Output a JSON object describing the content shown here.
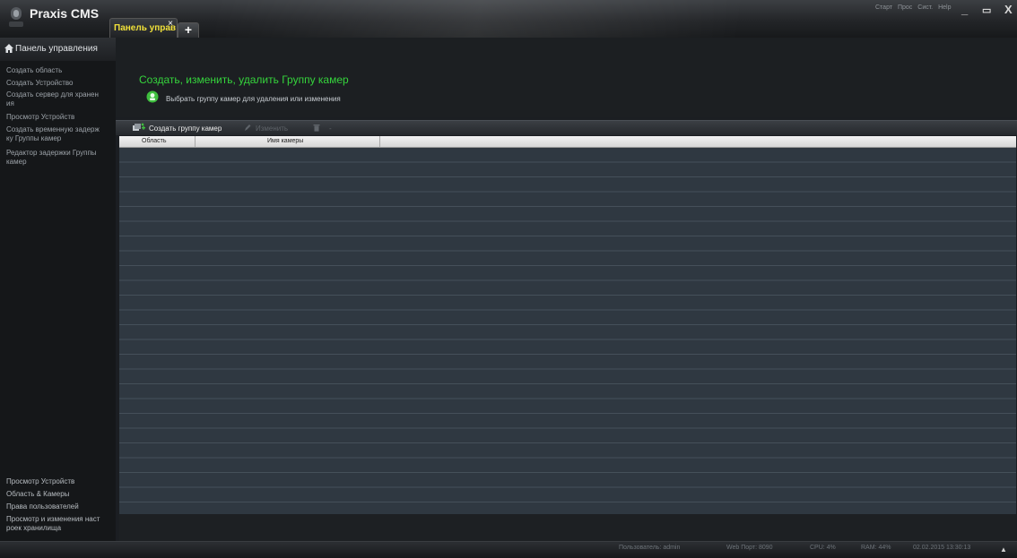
{
  "app": {
    "title": "Praxis CMS"
  },
  "tabs": [
    {
      "label": "Панель управ",
      "close": "×"
    },
    {
      "label": "+"
    }
  ],
  "top_menu": [
    "Старт",
    "Проc",
    "Сист.",
    "Help"
  ],
  "window_controls": [
    "_",
    "▭",
    "X"
  ],
  "sidebar": {
    "header": "Панель управления",
    "items": [
      "Создать область",
      "Создать Устройство",
      "Создать сервер для хранен\nия",
      "Просмотр Устройств",
      "Создать временную задерж\nку Группы камер",
      "Редактор задержки Группы\nкамер"
    ],
    "bottom_items": [
      "Просмотр Устройств",
      "Область & Камеры",
      "Права пользователей",
      "Просмотр и изменения наст\nроек хранилища"
    ]
  },
  "main": {
    "title": "Создать, изменить, удалить Группу камер",
    "info_text": "Выбрать группу камер для удаления или изменения",
    "toolbar": {
      "create_label": "Создать группу камер",
      "edit_label": "Изменить",
      "delete_label": "-"
    },
    "table": {
      "columns": [
        "Область",
        "Имя камеры"
      ],
      "rows": []
    }
  },
  "status": {
    "user": "Пользователь: admin",
    "port": "Web Порт: 8090",
    "cpu": "CPU: 4%",
    "ram": "RAM: 44%",
    "datetime": "02.02.2015 13:30:13"
  },
  "colors": {
    "accent_green": "#35d43c",
    "tab_label": "#f2e23a",
    "grid_row": "#2f3841"
  }
}
